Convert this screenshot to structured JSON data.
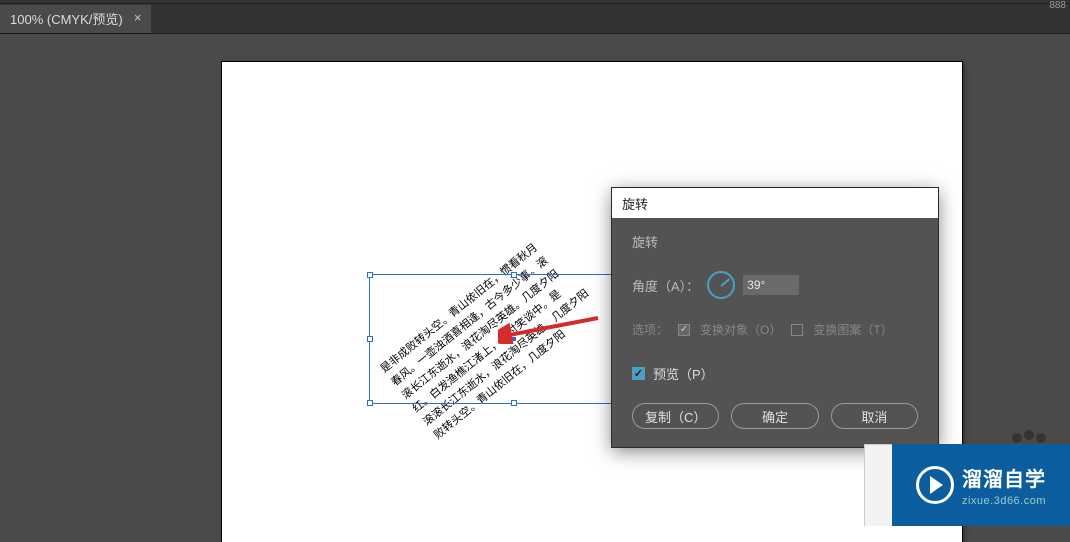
{
  "topbar": {
    "right_value": "888"
  },
  "tab": {
    "label": "100% (CMYK/预览)",
    "close": "×"
  },
  "canvas": {
    "text_content": "是非成败转头空。青山依旧在，惯看秋月\n春风。一壶浊酒喜相逢，古今多少事。滚\n滚长江东逝水，浪花淘尽英雄。几度夕阳\n红。白发渔樵江渚上，都付笑谈中。是\n滚滚长江东逝水，浪花淘尽英雄。几度夕阳\n败转头空。青山依旧在，几度夕阳"
  },
  "dialog": {
    "title": "旋转",
    "section": "旋转",
    "angle_label": "角度（A）：",
    "angle_value": "39°",
    "options_label": "选项：",
    "opt_transform_objects": "变换对象（O）",
    "opt_transform_patterns": "变换图案（T）",
    "preview_label": "预览（P）",
    "buttons": {
      "copy": "复制（C）",
      "ok": "确定",
      "cancel": "取消"
    }
  },
  "watermark": {
    "title": "溜溜自学",
    "url": "zixue.3d66.com"
  }
}
